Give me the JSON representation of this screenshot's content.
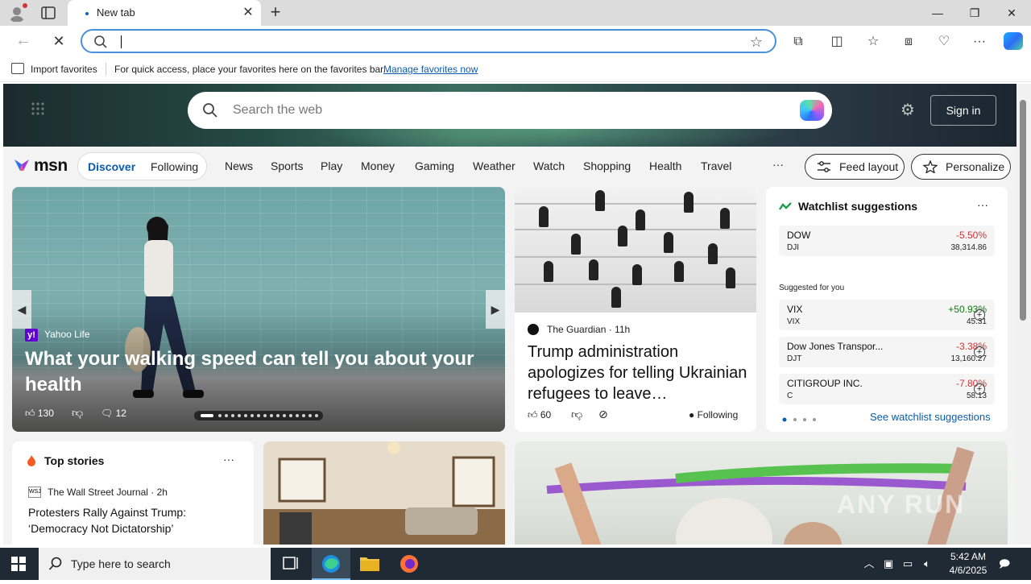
{
  "browser": {
    "tab_title": "New tab",
    "address_value": "",
    "favbar": {
      "import_label": "Import favorites",
      "message": "For quick access, place your favorites here on the favorites bar.",
      "manage_link": "Manage favorites now"
    }
  },
  "msn": {
    "search_placeholder": "Search the web",
    "sign_in": "Sign in",
    "logo_text": "msn",
    "pill": {
      "discover": "Discover",
      "following": "Following"
    },
    "nav": [
      "News",
      "Sports",
      "Play",
      "Money",
      "Gaming",
      "Weather",
      "Watch",
      "Shopping",
      "Health",
      "Travel"
    ],
    "nav_more": "···",
    "feed_layout": "Feed layout",
    "personalize": "Personalize"
  },
  "carousel": {
    "source": "Yahoo Life",
    "headline": "What your walking speed can tell you about your health",
    "likes": "130",
    "comments": "12"
  },
  "guardian": {
    "source": "The Guardian · 11h",
    "title": "Trump administration apologizes for telling Ukrainian refugees to leave…",
    "likes": "60",
    "following": "Following"
  },
  "watchlist": {
    "title": "Watchlist suggestions",
    "more": "···",
    "suggested_label": "Suggested for you",
    "see_link": "See watchlist suggestions",
    "items": [
      {
        "name": "DOW",
        "ticker": "DJI",
        "change": "-5.50%",
        "price": "38,314.86",
        "color": "#d13438"
      },
      {
        "name": "VIX",
        "ticker": "VIX",
        "change": "+50.93%",
        "price": "45.31",
        "color": "#107c10"
      },
      {
        "name": "Dow Jones Transpor...",
        "ticker": "DJT",
        "change": "-3.38%",
        "price": "13,160.27",
        "color": "#d13438"
      },
      {
        "name": "CITIGROUP INC.",
        "ticker": "C",
        "change": "-7.80%",
        "price": "58.13",
        "color": "#d13438"
      }
    ]
  },
  "top_stories": {
    "title": "Top stories",
    "more": "···",
    "source_badge": "WSJ",
    "source": "The Wall Street Journal · 2h",
    "headline": "Protesters Rally Against Trump: ‘Democracy Not Dictatorship’"
  },
  "watermark": "ANY RUN",
  "taskbar": {
    "search_placeholder": "Type here to search",
    "time": "5:42 AM",
    "date": "4/6/2025"
  },
  "colors": {
    "accent": "#0b5cad",
    "negative": "#d13438",
    "positive": "#107c10"
  }
}
